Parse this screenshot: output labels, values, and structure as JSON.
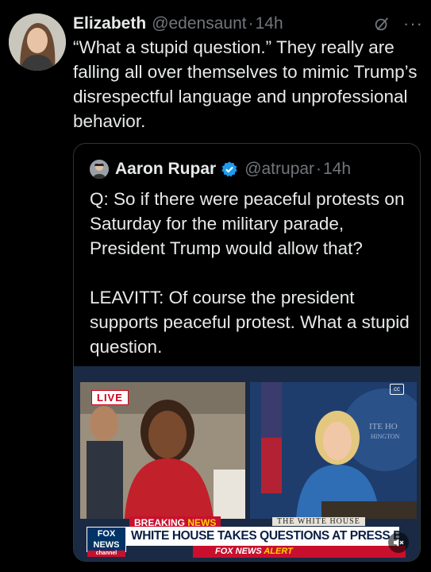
{
  "tweet": {
    "author_name": "Elizabeth",
    "author_handle": "@edensaunt",
    "separator": "·",
    "time": "14h",
    "text": "“What a stupid question.”  They really are falling all over themselves to mimic Trump’s disrespectful language and unprofessional behavior."
  },
  "quoted_tweet": {
    "author_name": "Aaron Rupar",
    "author_handle": "@atrupar",
    "separator": "·",
    "time": "14h",
    "text_para1": "Q: So if there were peaceful protests on Saturday for the military parade, President Trump would allow that?",
    "text_para2": "LEAVITT: Of course the president supports peaceful protest. What a stupid question.",
    "media": {
      "live_badge": "LIVE",
      "breaking_label": "BREAKING",
      "breaking_news": "NEWS",
      "wh_sign": "THE WHITE HOUSE",
      "fox_logo_line1": "FOX",
      "fox_logo_line2": "NEWS",
      "fox_logo_line3": "channel",
      "headline": "WHITE HOUSE TAKES QUESTIONS AT PRESS BRIEFING",
      "alert_part1": "FOX NEWS",
      "alert_part2": "ALERT",
      "cc": "cc",
      "backdrop_text1": "ITE HO",
      "backdrop_text2": "HINGTON"
    }
  },
  "icons": {
    "grok": "grok-icon",
    "more": "more-icon",
    "verified": "verified-icon",
    "mute": "mute-icon",
    "captions": "captions-icon"
  },
  "colors": {
    "background": "#000000",
    "text": "#e7e9ea",
    "muted": "#71767b",
    "border": "#2f3336",
    "verified": "#1d9bf0",
    "fox_red": "#c8102e",
    "fox_blue": "#003366"
  }
}
